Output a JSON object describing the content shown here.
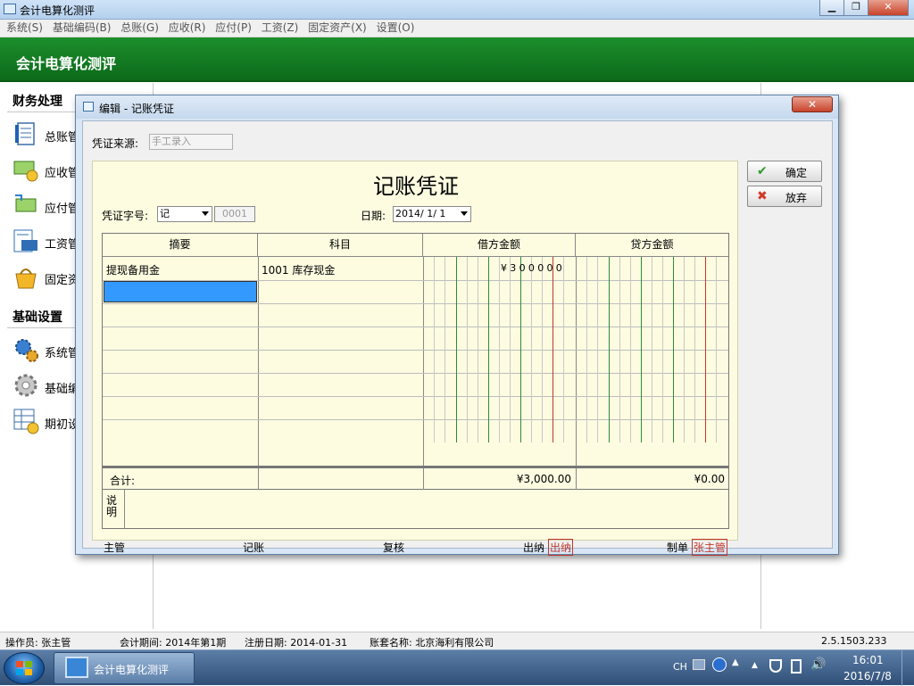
{
  "app": {
    "title": "会计电算化测评",
    "banner_title": "会计电算化测评"
  },
  "window_controls": {
    "minimize": "▁",
    "restore": "❐",
    "close": "✕"
  },
  "menu": [
    "系统(S)",
    "基础编码(B)",
    "总账(G)",
    "应收(R)",
    "应付(P)",
    "工资(Z)",
    "固定资产(X)",
    "设置(O)"
  ],
  "sidebar": {
    "section1": "财务处理",
    "items1": [
      {
        "label": "总账管",
        "icon": "ledger-icon"
      },
      {
        "label": "应收管",
        "icon": "receivable-icon"
      },
      {
        "label": "应付管",
        "icon": "payable-icon"
      },
      {
        "label": "工资管",
        "icon": "payroll-icon"
      },
      {
        "label": "固定资",
        "icon": "fixed-asset-icon"
      }
    ],
    "section2": "基础设置",
    "items2": [
      {
        "label": "系统管",
        "icon": "gears-icon"
      },
      {
        "label": "基础编",
        "icon": "gear-icon"
      },
      {
        "label": "期初设",
        "icon": "table-icon"
      }
    ]
  },
  "dialog": {
    "title": "编辑 - 记账凭证",
    "source_label": "凭证来源:",
    "source_value": "手工录入",
    "voucher_title": "记账凭证",
    "voucher_type_label": "凭证字号:",
    "voucher_type_value": "记",
    "voucher_number": "0001",
    "date_label": "日期:",
    "date_value": "2014/ 1/ 1",
    "columns": [
      "摘要",
      "科目",
      "借方金额",
      "贷方金额"
    ],
    "rows": [
      {
        "summary": "提现备用金",
        "account": "1001 库存现金",
        "debit": "¥300000",
        "credit": ""
      }
    ],
    "total_label": "合计:",
    "total_debit": "¥3,000.00",
    "total_credit": "¥0.00",
    "note_label": "说明",
    "signatures": [
      {
        "label": "主管",
        "value": ""
      },
      {
        "label": "记账",
        "value": ""
      },
      {
        "label": "复核",
        "value": ""
      },
      {
        "label": "出纳",
        "value": "出纳"
      },
      {
        "label": "制单",
        "value": "张主管"
      }
    ],
    "confirm_label": "确定",
    "cancel_label": "放弃",
    "close_label": "✕"
  },
  "statusbar": {
    "operator": "操作员: 张主管",
    "period": "会计期间: 2014年第1期",
    "reg_date": "注册日期: 2014-01-31",
    "account_set": "账套名称: 北京海利有限公司",
    "version": "2.5.1503.233"
  },
  "taskbar": {
    "task_label": "会计电算化测评",
    "lang": "CH",
    "time": "16:01",
    "date": "2016/7/8"
  },
  "colors": {
    "banner": "#1c8f2c",
    "selection": "#3399ff",
    "voucher_bg": "#fdfbe0",
    "green_line": "#2e8b3a",
    "red_line": "#c0392b"
  }
}
